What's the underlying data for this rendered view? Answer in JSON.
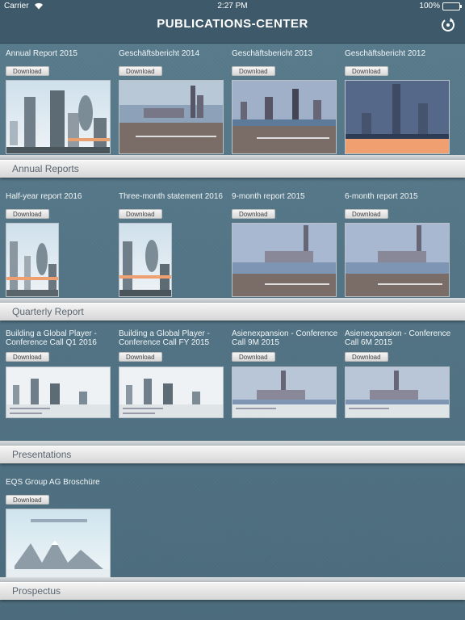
{
  "status": {
    "carrier": "Carrier",
    "time": "2:27 PM",
    "battery": "100%"
  },
  "nav": {
    "title": "PUBLICATIONS-CENTER"
  },
  "download_label": "Download",
  "sections": [
    {
      "label": "Annual Reports",
      "items": [
        "Annual Report 2015",
        "Geschäftsbericht 2014",
        "Geschäftsbericht 2013",
        "Geschäftsbericht 2012"
      ]
    },
    {
      "label": "Quarterly Report",
      "items": [
        "Half-year report 2016",
        "Three-month statement 2016",
        "9-month report 2015",
        "6-month report 2015"
      ]
    },
    {
      "label": "Presentations",
      "items": [
        "Building a Global Player - Conference Call Q1 2016",
        "Building a Global Player - Conference Call FY 2015",
        "Asienexpansion - Conference Call 9M 2015",
        "Asienexpansion - Conference Call 6M 2015"
      ]
    },
    {
      "label": "Prospectus",
      "items": [
        "EQS Group AG Broschüre"
      ]
    }
  ],
  "colors": {
    "background": "#4f6f80",
    "navbar": "#3e5a6a",
    "shelf": "#e8e8e8"
  }
}
